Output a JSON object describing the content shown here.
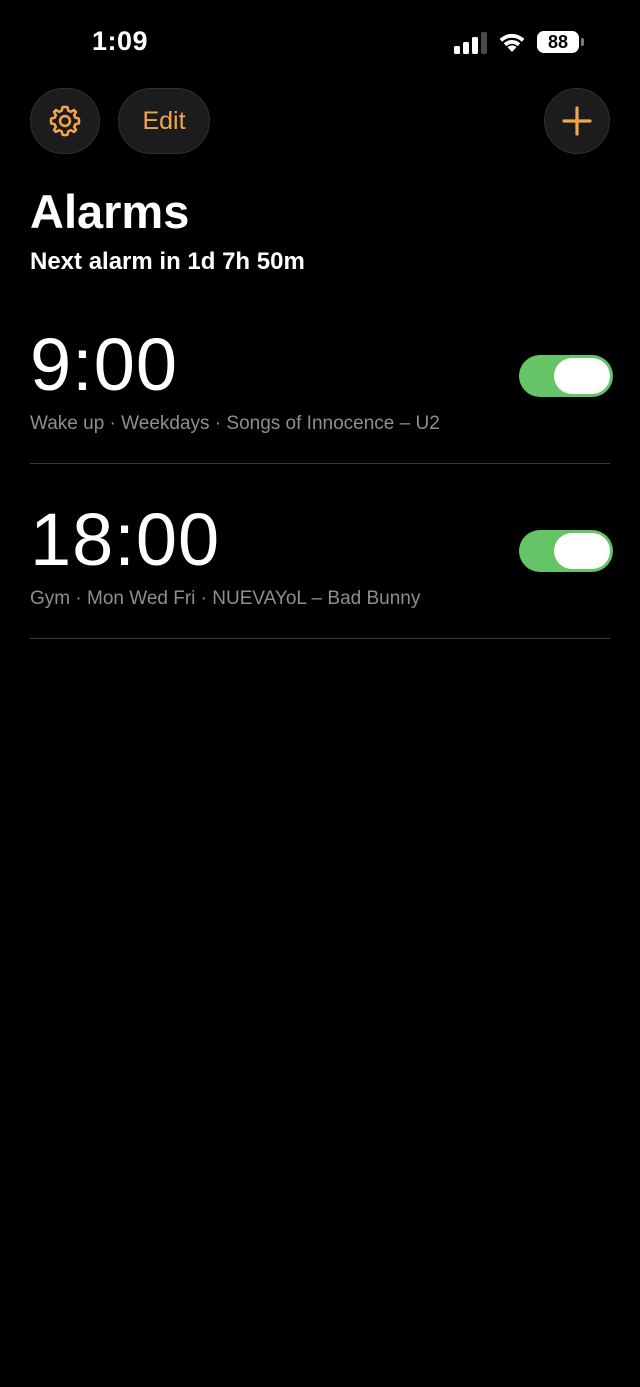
{
  "status_bar": {
    "time": "1:09",
    "battery_level": "88",
    "signal_icon": "cellular-signal-icon",
    "wifi_icon": "wifi-icon"
  },
  "toolbar": {
    "settings_icon": "gear-icon",
    "edit_label": "Edit",
    "add_icon": "plus-icon",
    "accent_color": "#f3a54a"
  },
  "header": {
    "title": "Alarms",
    "subtitle": "Next alarm in 1d 7h 50m"
  },
  "alarms": [
    {
      "time": "9:00",
      "detail": "Wake up · Weekdays · Songs of Innocence – U2",
      "enabled": true
    },
    {
      "time": "18:00",
      "detail": "Gym · Mon Wed Fri · NUEVAYoL – Bad Bunny",
      "enabled": true
    }
  ],
  "colors": {
    "toggle_on": "#65c466",
    "background": "#000000"
  }
}
